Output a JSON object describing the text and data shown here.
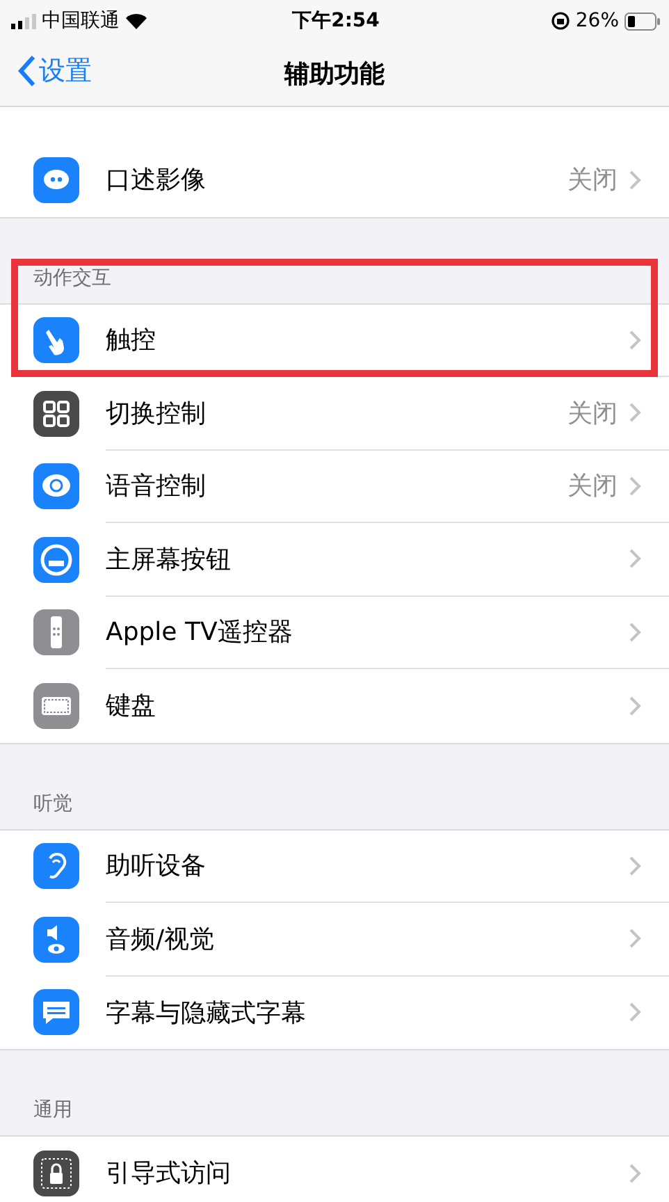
{
  "status_bar": {
    "carrier": "中国联通",
    "time": "下午2:54",
    "battery": "26%"
  },
  "nav": {
    "back": "设置",
    "title": "辅助功能"
  },
  "groups": [
    {
      "rows": [
        {
          "label": "口述影像",
          "value": "关闭",
          "color": "#1a82fb"
        }
      ]
    },
    {
      "header": "动作交互",
      "rows": [
        {
          "label": "触控",
          "color": "#1a82fb",
          "highlighted": true
        },
        {
          "label": "切换控制",
          "value": "关闭",
          "color": "#4a4a4c"
        },
        {
          "label": "语音控制",
          "value": "关闭",
          "color": "#1a82fb"
        },
        {
          "label": "主屏幕按钮",
          "color": "#1a82fb"
        },
        {
          "label": "Apple TV遥控器",
          "color": "#8e8e93"
        },
        {
          "label": "键盘",
          "color": "#8e8e93"
        }
      ]
    },
    {
      "header": "听觉",
      "rows": [
        {
          "label": "助听设备",
          "color": "#1a82fb"
        },
        {
          "label": "音频/视觉",
          "color": "#1a82fb"
        },
        {
          "label": "字幕与隐藏式字幕",
          "color": "#1a82fb"
        }
      ]
    },
    {
      "header": "通用",
      "rows": [
        {
          "label": "引导式访问",
          "color": "#4a4a4c"
        }
      ]
    }
  ]
}
